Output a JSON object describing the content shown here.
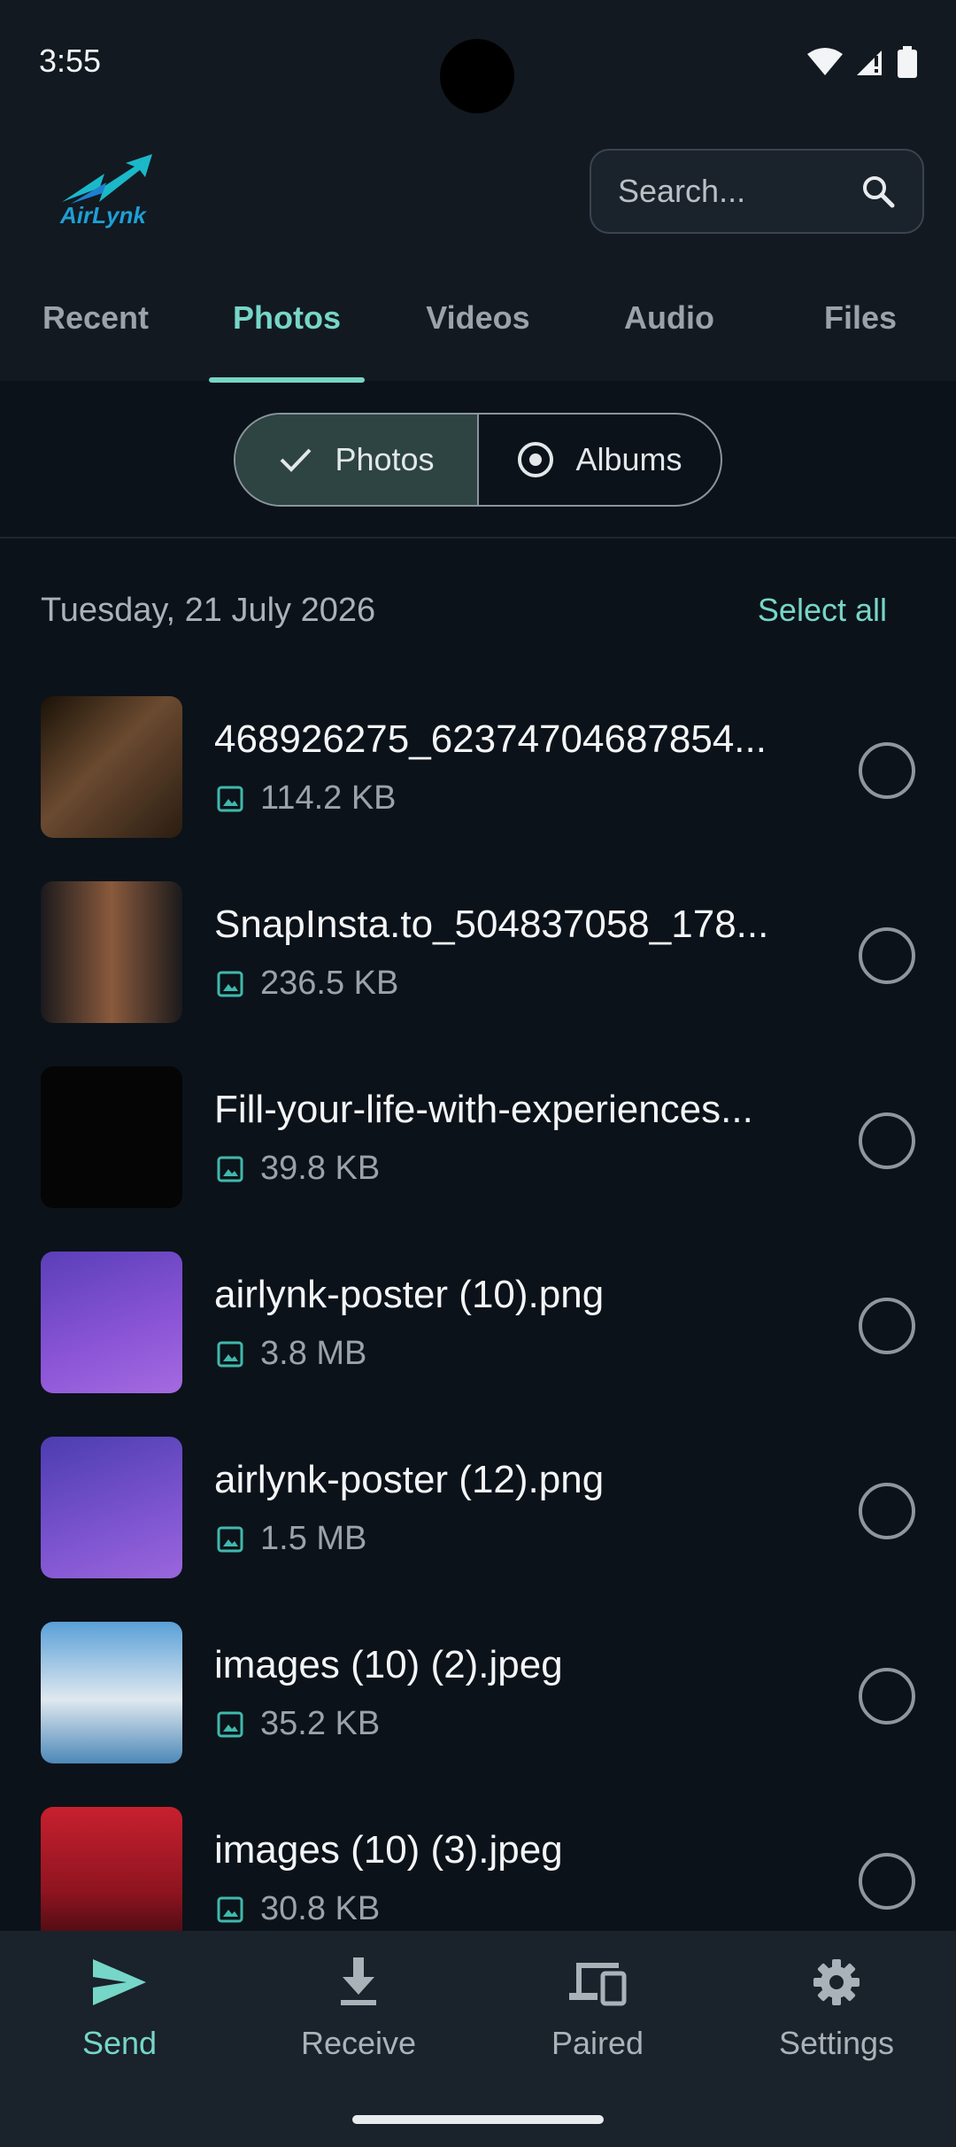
{
  "status": {
    "time": "3:55"
  },
  "app": {
    "logo_text": "AirLynk"
  },
  "search": {
    "placeholder": "Search..."
  },
  "tabs": [
    {
      "label": "Recent"
    },
    {
      "label": "Photos"
    },
    {
      "label": "Videos"
    },
    {
      "label": "Audio"
    },
    {
      "label": "Files"
    }
  ],
  "toggle": {
    "photos_label": "Photos",
    "albums_label": "Albums"
  },
  "section": {
    "date": "Tuesday, 21 July 2026",
    "select_all": "Select all"
  },
  "files": [
    {
      "name": "468926275_62374704687854...",
      "size": "114.2 KB"
    },
    {
      "name": "SnapInsta.to_504837058_178...",
      "size": "236.5 KB"
    },
    {
      "name": "Fill-your-life-with-experiences...",
      "size": "39.8 KB"
    },
    {
      "name": "airlynk-poster (10).png",
      "size": "3.8 MB"
    },
    {
      "name": "airlynk-poster (12).png",
      "size": "1.5 MB"
    },
    {
      "name": "images (10) (2).jpeg",
      "size": "35.2 KB"
    },
    {
      "name": "images (10) (3).jpeg",
      "size": "30.8 KB"
    }
  ],
  "nav": [
    {
      "label": "Send"
    },
    {
      "label": "Receive"
    },
    {
      "label": "Paired"
    },
    {
      "label": "Settings"
    }
  ],
  "colors": {
    "accent": "#76d6c8",
    "background": "#0c1219",
    "surface": "#1a222b"
  }
}
